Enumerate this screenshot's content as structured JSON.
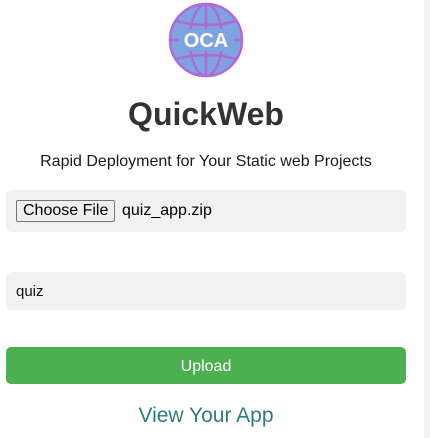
{
  "logo": {
    "text": "OCA",
    "icon": "globe-logo",
    "fill_color": "#7ea3e0",
    "line_color": "#b06ad6"
  },
  "app": {
    "title": "QuickWeb",
    "subtitle": "Rapid Deployment for Your Static web Projects"
  },
  "upload_form": {
    "choose_file_label": "Choose File",
    "selected_file": "quiz_app.zip",
    "name_value": "quiz",
    "upload_label": "Upload",
    "upload_color": "#4caf50"
  },
  "view_link": {
    "label": "View Your App",
    "color": "#2f7c7a"
  }
}
